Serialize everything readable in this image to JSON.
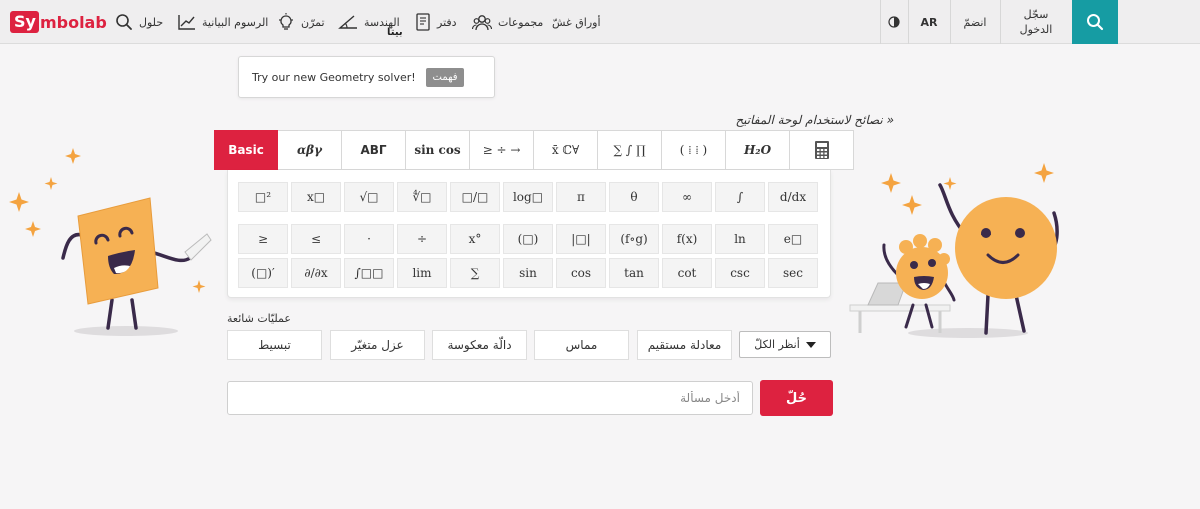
{
  "header": {
    "logo_prefix": "Sy",
    "logo_rest": "mbolab",
    "nav": {
      "solutions": "حلول",
      "graphing": "الرسوم البيانية",
      "practice": "تمرّن",
      "geometry": "الهندسة",
      "geometry_badge": "بيتا",
      "notebook": "دفتر",
      "groups": "مجموعات",
      "cheat_sheets": "أوراق غشّ"
    },
    "language": "AR",
    "join": "انضمّ",
    "login": "سجّل الدخول"
  },
  "popup": {
    "message": "Try our new Geometry solver!",
    "dismiss": "فهمت"
  },
  "keyboard": {
    "tips_link": "« نصائح لاستخدام لوحة المفاتيح",
    "tabs": [
      "Basic",
      "αβγ",
      "ΑΒΓ",
      "sin cos",
      "≥ ÷ →",
      "x̄ ℂ∀",
      "∑ ∫ ∏",
      "( ⁞ ⁞ )",
      "H₂O",
      ""
    ],
    "keys": [
      [
        "□²",
        "x□",
        "√□",
        "∜□",
        "□/□",
        "log□",
        "π",
        "θ",
        "∞",
        "∫",
        "d/dx"
      ],
      [
        "≥",
        "≤",
        "·",
        "÷",
        "x°",
        "(□)",
        "|□|",
        "(f∘g)",
        "f(x)",
        "ln",
        "e□"
      ],
      [
        "(□)′",
        "∂/∂x",
        "∫□□",
        "lim",
        "∑",
        "sin",
        "cos",
        "tan",
        "cot",
        "csc",
        "sec"
      ]
    ]
  },
  "operations": {
    "title": "عمليّات شائعة",
    "items": [
      "تبسيط",
      "عزل متغيّر",
      "دالّة معكوسة",
      "مماس",
      "معادلة مستقيم"
    ],
    "view_all": "أنظر الكلّ"
  },
  "input": {
    "placeholder": "أدخل مسألة",
    "value": ""
  },
  "solve_label": "حُلّ",
  "colors": {
    "accent": "#dd2240",
    "teal": "#169ca3"
  }
}
